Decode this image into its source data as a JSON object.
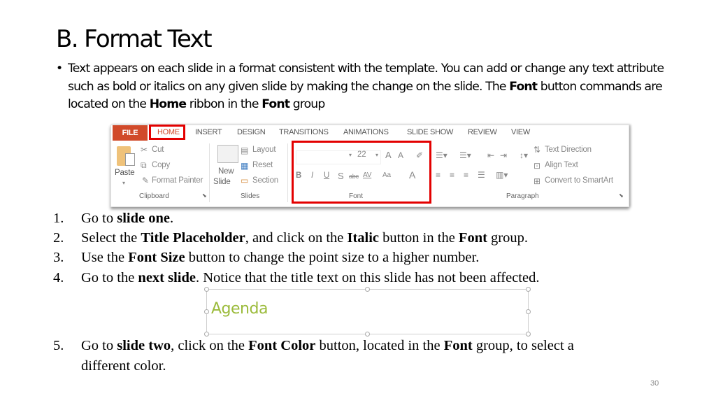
{
  "slide": {
    "title": "B. Format Text",
    "bullet": {
      "marker": "•",
      "text_1": "Text appears on each slide in a format consistent with the template. You can add or change any text attribute such as bold or italics on any given slide by making the change on the slide. The ",
      "bold_1": "Font",
      "text_2": " button commands are located on the ",
      "bold_2": "Home",
      "text_3": " ribbon in the ",
      "bold_3": "Font",
      "text_4": " group"
    },
    "ribbon": {
      "tabs": [
        "FILE",
        "HOME",
        "INSERT",
        "DESIGN",
        "TRANSITIONS",
        "ANIMATIONS",
        "SLIDE SHOW",
        "REVIEW",
        "VIEW"
      ],
      "highlight_color": "#e30000",
      "file_tab_color": "#d14a2a",
      "clipboard": {
        "paste": "Paste",
        "cut": "Cut",
        "copy": "Copy",
        "format_painter": "Format Painter",
        "label": "Clipboard"
      },
      "slides": {
        "new_slide_1": "New",
        "new_slide_2": "Slide",
        "layout": "Layout",
        "reset": "Reset",
        "section": "Section",
        "label": "Slides"
      },
      "font": {
        "size": "22",
        "bold": "B",
        "italic": "I",
        "underline": "U",
        "shadow": "S",
        "strike": "abc",
        "spacing": "AV",
        "case": "Aa",
        "color": "A",
        "grow": "A",
        "shrink": "A",
        "label": "Font"
      },
      "paragraph": {
        "text_direction": "Text Direction",
        "align_text": "Align Text",
        "smartart": "Convert to SmartArt",
        "label": "Paragraph"
      }
    },
    "steps": [
      {
        "num": "1.",
        "parts": [
          [
            "Go to ",
            false
          ],
          [
            "slide one",
            true
          ],
          [
            ".",
            false
          ]
        ]
      },
      {
        "num": "2.",
        "parts": [
          [
            "Select the ",
            false
          ],
          [
            "Title Placeholder",
            true
          ],
          [
            ", and click on the ",
            false
          ],
          [
            "Italic",
            true
          ],
          [
            " button in the ",
            false
          ],
          [
            "Font",
            true
          ],
          [
            " group.",
            false
          ]
        ]
      },
      {
        "num": "3.",
        "parts": [
          [
            "Use the ",
            false
          ],
          [
            "Font Size",
            true
          ],
          [
            " button to change the point size to a higher number.",
            false
          ]
        ]
      },
      {
        "num": "4.",
        "parts": [
          [
            "Go to the ",
            false
          ],
          [
            "next slide",
            true
          ],
          [
            ". Notice that the title text on this slide has not been affected.",
            false
          ]
        ]
      }
    ],
    "agenda_sample": {
      "text": "Agenda",
      "color": "#9bbb3b"
    },
    "step5": {
      "num": "5.",
      "t1": "Go to ",
      "b1": "slide two",
      "t2": ", click on the ",
      "b2": "Font Color",
      "t3": " button, located in the ",
      "b3": "Font",
      "t4": " group, to select a different color."
    },
    "page_number": "30"
  }
}
